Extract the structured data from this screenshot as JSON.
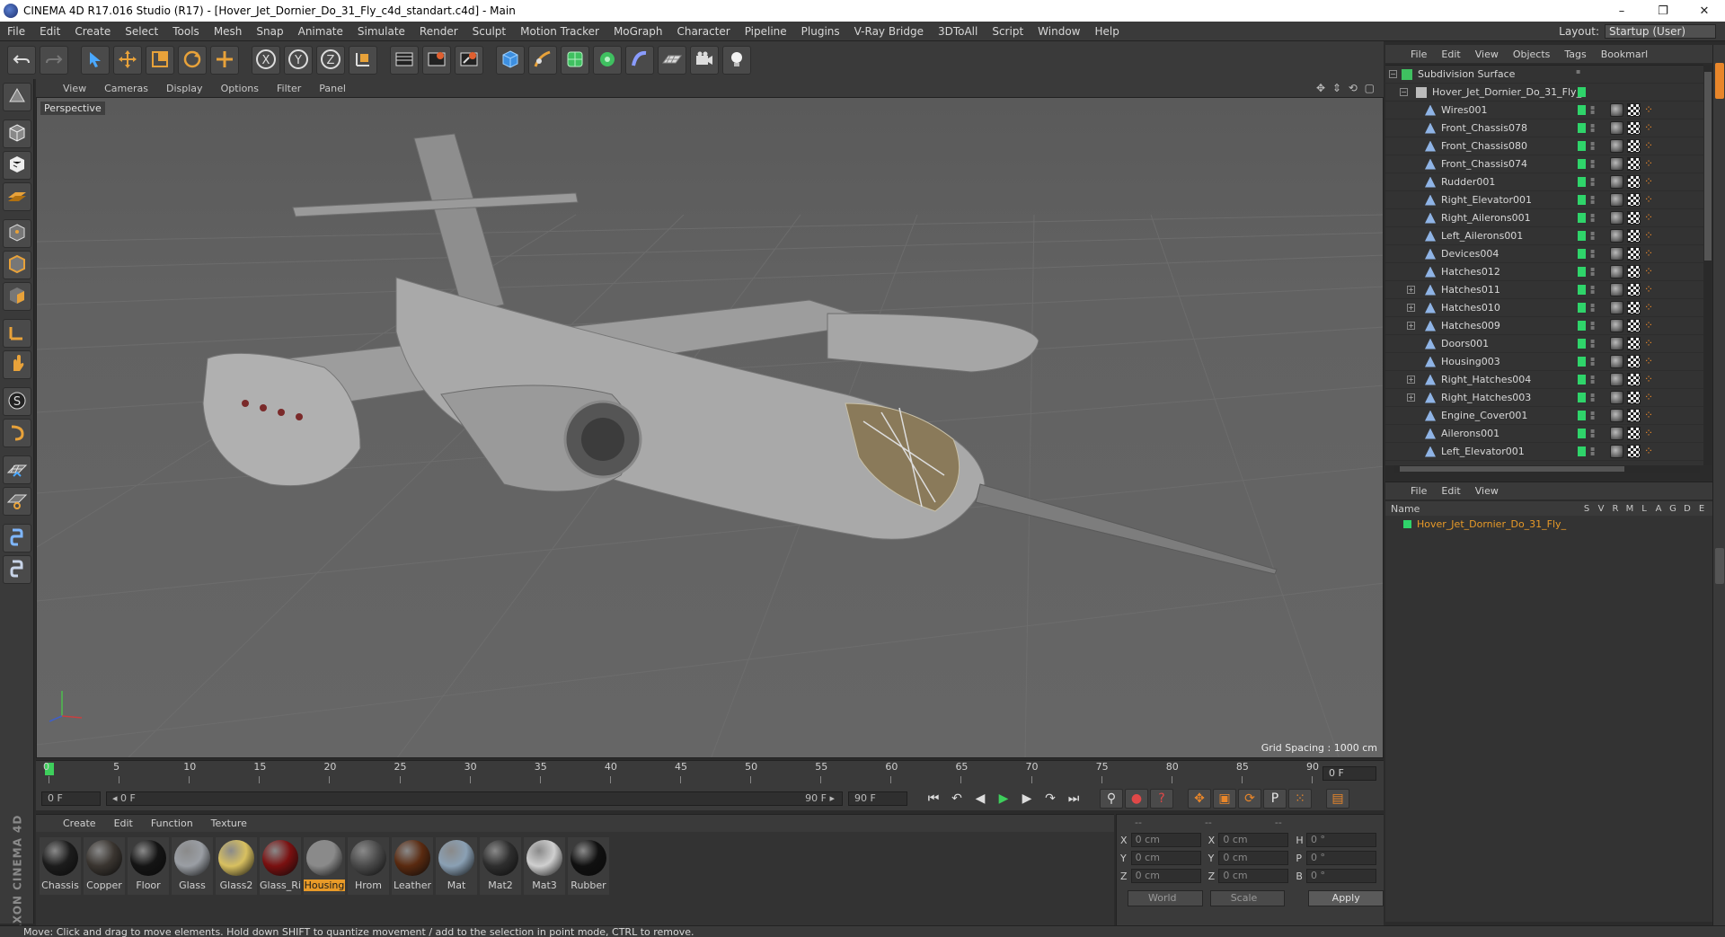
{
  "window": {
    "title": "CINEMA 4D R17.016 Studio (R17) - [Hover_Jet_Dornier_Do_31_Fly_c4d_standart.c4d] - Main",
    "minimize": "–",
    "restore": "❐",
    "close": "✕"
  },
  "menu": [
    "File",
    "Edit",
    "Create",
    "Select",
    "Tools",
    "Mesh",
    "Snap",
    "Animate",
    "Simulate",
    "Render",
    "Sculpt",
    "Motion Tracker",
    "MoGraph",
    "Character",
    "Pipeline",
    "Plugins",
    "V-Ray Bridge",
    "3DToAll",
    "Script",
    "Window",
    "Help"
  ],
  "layout": {
    "label": "Layout:",
    "value": "Startup (User)"
  },
  "toolbar": {
    "icons": [
      "undo-icon",
      "redo-icon",
      "select-icon",
      "move-icon",
      "scale-icon",
      "rotate-icon",
      "add-icon",
      "x-axis-icon",
      "y-axis-icon",
      "z-axis-icon",
      "coordinate-system-icon",
      "render-view-icon",
      "render-picture-viewer-icon",
      "edit-render-settings-icon",
      "cube-icon",
      "pen-icon",
      "subdivision-icon",
      "array-icon",
      "deformer-icon",
      "floor-icon",
      "camera-icon",
      "light-icon"
    ],
    "axis_x": "X",
    "axis_y": "Y",
    "axis_z": "Z"
  },
  "viewport": {
    "menu": [
      "View",
      "Cameras",
      "Display",
      "Options",
      "Filter",
      "Panel"
    ],
    "label": "Perspective",
    "grid_spacing": "Grid Spacing : 1000 cm",
    "nav": "✥ ⇕ ⟲ ▢",
    "bg_color": "#606060"
  },
  "timeline": {
    "ticks": [
      "0",
      "5",
      "10",
      "15",
      "20",
      "25",
      "30",
      "35",
      "40",
      "45",
      "50",
      "55",
      "60",
      "65",
      "70",
      "75",
      "80",
      "85",
      "90"
    ],
    "frame": "0 F"
  },
  "transport": {
    "start": "0 F",
    "range_start": "◂ 0 F",
    "range_end": "90 F ▸",
    "end": "90 F"
  },
  "materials": {
    "menu": [
      "Create",
      "Edit",
      "Function",
      "Texture"
    ],
    "items": [
      {
        "name": "Chassis",
        "color": "#1c1c1c"
      },
      {
        "name": "Copper",
        "color": "#3a3530"
      },
      {
        "name": "Floor",
        "color": "#141414"
      },
      {
        "name": "Glass",
        "color": "#9a9ea4"
      },
      {
        "name": "Glass2",
        "color": "#d8c060"
      },
      {
        "name": "Glass_Ri",
        "color": "#7a1010"
      },
      {
        "name": "Housing",
        "color": "#8a8a8a"
      },
      {
        "name": "Hrom",
        "color": "#4a4a4a"
      },
      {
        "name": "Leather",
        "color": "#5a2a10"
      },
      {
        "name": "Mat",
        "color": "#8aa0b4"
      },
      {
        "name": "Mat2",
        "color": "#2e2e2e"
      },
      {
        "name": "Mat3",
        "color": "#cfcfcf"
      },
      {
        "name": "Rubber",
        "color": "#101010"
      }
    ],
    "active": "Housing"
  },
  "coords": {
    "headers": [
      "--",
      "--",
      "--"
    ],
    "rows": [
      {
        "a1": "X",
        "v1": "0 cm",
        "a2": "X",
        "v2": "0 cm",
        "a3": "H",
        "v3": "0 °"
      },
      {
        "a1": "Y",
        "v1": "0 cm",
        "a2": "Y",
        "v2": "0 cm",
        "a3": "P",
        "v3": "0 °"
      },
      {
        "a1": "Z",
        "v1": "0 cm",
        "a2": "Z",
        "v2": "0 cm",
        "a3": "B",
        "v3": "0 °"
      }
    ],
    "world": "World",
    "scale": "Scale",
    "apply": "Apply"
  },
  "status": "Move: Click and drag to move elements. Hold down SHIFT to quantize movement / add to the selection in point mode, CTRL to remove.",
  "object_manager": {
    "menu": [
      "File",
      "Edit",
      "View",
      "Objects",
      "Tags",
      "Bookmarl"
    ],
    "root": "Subdivision Surface",
    "group": "Hover_Jet_Dornier_Do_31_Fly_",
    "objects": [
      {
        "name": "Wires001",
        "expand": false
      },
      {
        "name": "Front_Chassis078",
        "expand": false
      },
      {
        "name": "Front_Chassis080",
        "expand": false
      },
      {
        "name": "Front_Chassis074",
        "expand": false
      },
      {
        "name": "Rudder001",
        "expand": false
      },
      {
        "name": "Right_Elevator001",
        "expand": false
      },
      {
        "name": "Right_Ailerons001",
        "expand": false
      },
      {
        "name": "Left_Ailerons001",
        "expand": false
      },
      {
        "name": "Devices004",
        "expand": false
      },
      {
        "name": "Hatches012",
        "expand": false
      },
      {
        "name": "Hatches011",
        "expand": true
      },
      {
        "name": "Hatches010",
        "expand": true
      },
      {
        "name": "Hatches009",
        "expand": true
      },
      {
        "name": "Doors001",
        "expand": false
      },
      {
        "name": "Housing003",
        "expand": false
      },
      {
        "name": "Right_Hatches004",
        "expand": true
      },
      {
        "name": "Right_Hatches003",
        "expand": true
      },
      {
        "name": "Engine_Cover001",
        "expand": false
      },
      {
        "name": "Ailerons001",
        "expand": false
      },
      {
        "name": "Left_Elevator001",
        "expand": false
      }
    ]
  },
  "layer_manager": {
    "menu": [
      "File",
      "Edit",
      "View"
    ],
    "name_header": "Name",
    "columns": [
      "S",
      "V",
      "R",
      "M",
      "L",
      "A",
      "G",
      "D",
      "E"
    ],
    "layer": "Hover_Jet_Dornier_Do_31_Fly_"
  }
}
